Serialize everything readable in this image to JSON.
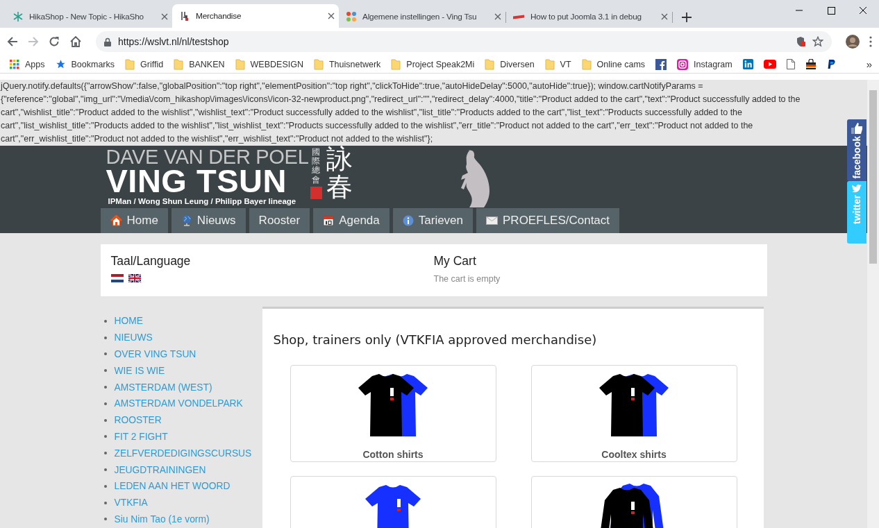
{
  "browser": {
    "tabs": [
      {
        "title": "HikaShop - New Topic - HikaSho",
        "selected": false
      },
      {
        "title": "Merchandise",
        "selected": true
      },
      {
        "title": "Algemene instellingen - Ving Tsu",
        "selected": false
      },
      {
        "title": "How to put Joomla 3.1 in debug",
        "selected": false
      }
    ],
    "forward": {
      "disabled": true
    },
    "url": "https://wslvt.nl/nl/testshop",
    "bookmarks": [
      {
        "kind": "apps",
        "label": "Apps"
      },
      {
        "kind": "star",
        "label": "Bookmarks"
      },
      {
        "kind": "folder",
        "label": "Griffid"
      },
      {
        "kind": "folder",
        "label": "BANKEN"
      },
      {
        "kind": "folder",
        "label": "WEBDESIGN"
      },
      {
        "kind": "folder",
        "label": "Thuisnetwerk"
      },
      {
        "kind": "folder",
        "label": "Project Speak2Mi"
      },
      {
        "kind": "folder",
        "label": "Diversen"
      },
      {
        "kind": "folder",
        "label": "VT"
      },
      {
        "kind": "folder",
        "label": "Online cams"
      },
      {
        "kind": "facebook"
      },
      {
        "kind": "instagram",
        "label": "Instagram"
      },
      {
        "kind": "linkedin"
      },
      {
        "kind": "youtube"
      },
      {
        "kind": "page"
      },
      {
        "kind": "shop"
      },
      {
        "kind": "paypal"
      }
    ],
    "bookmarks_overflow": "»"
  },
  "page": {
    "script_text": "jQuery.notify.defaults({\"arrowShow\":false,\"globalPosition\":\"top right\",\"elementPosition\":\"top right\",\"clickToHide\":true,\"autoHideDelay\":5000,\"autoHide\":true}); window.cartNotifyParams = {\"reference\":\"global\",\"img_url\":\"\\/media\\/com_hikashop\\/images\\/icons\\/icon-32-newproduct.png\",\"redirect_url\":\"\",\"redirect_delay\":4000,\"title\":\"Product added to the cart\",\"text\":\"Product successfully added to the cart\",\"wishlist_title\":\"Product added to the wishlist\",\"wishlist_text\":\"Product successfully added to the wishlist\",\"list_title\":\"Products added to the cart\",\"list_text\":\"Products successfully added to the cart\",\"list_wishlist_title\":\"Products added to the wishlist\",\"list_wishlist_text\":\"Products successfully added to the wishlist\",\"err_title\":\"Product not added to the cart\",\"err_text\":\"Product not added to the cart\",\"err_wishlist_title\":\"Product not added to the wishlist\",\"err_wishlist_text\":\"Product not added to the wishlist\"};",
    "logo": {
      "line1": "DAVE VAN DER POEL",
      "line2": "VING TSUN",
      "tagline": "IPMan / Wong Shun Leung / Philipp Bayer lineage",
      "chinese_small": "國際總會",
      "chinese_large": "詠春"
    },
    "nav": [
      {
        "kind": "home",
        "label": "Home"
      },
      {
        "kind": "globe",
        "label": "Nieuws"
      },
      {
        "kind": "none",
        "label": "Rooster"
      },
      {
        "kind": "calendar",
        "label": "Agenda"
      },
      {
        "kind": "info",
        "label": "Tarieven"
      },
      {
        "kind": "mail",
        "label": "PROEFLES/Contact"
      }
    ],
    "language": {
      "title": "Taal/Language",
      "flags": [
        {
          "kind": "nl"
        },
        {
          "kind": "uk"
        }
      ]
    },
    "cart": {
      "title": "My Cart",
      "status": "The cart is empty"
    },
    "menu": [
      "HOME",
      "NIEUWS",
      "OVER VING TSUN",
      "WIE IS WIE",
      "AMSTERDAM (WEST)",
      "AMSTERDAM VONDELPARK",
      "ROOSTER",
      "FIT 2 FIGHT",
      "ZELFVERDEDIGINGSCURSUS",
      "JEUGDTRAININGEN",
      "LEDEN AAN HET WOORD",
      "VTKFIA",
      "Siu Nim Tao (1e vorm)"
    ],
    "shop": {
      "heading": "Shop, trainers only (VTKFIA approved merchandise)",
      "products": [
        {
          "kind": "tee-pair",
          "name": "Cotton shirts"
        },
        {
          "kind": "tee-pair",
          "name": "Cooltex shirts"
        },
        {
          "kind": "tee-blue"
        },
        {
          "kind": "longsleeve-pair"
        }
      ]
    }
  },
  "social": [
    {
      "kind": "facebook",
      "label": "facebook"
    },
    {
      "kind": "twitter",
      "label": "twitter"
    }
  ]
}
